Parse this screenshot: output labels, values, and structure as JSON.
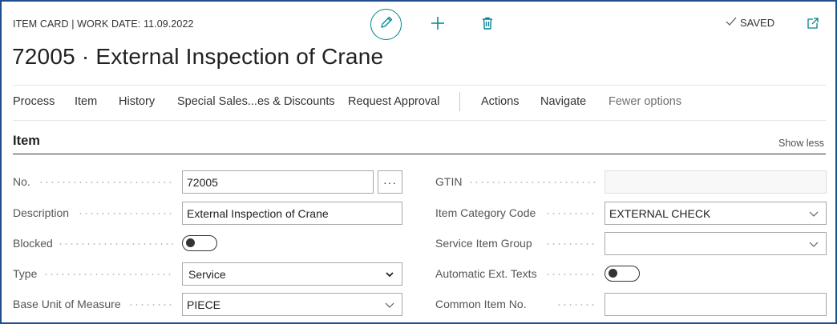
{
  "header": {
    "caption": "ITEM CARD | WORK DATE: 11.09.2022",
    "title": "72005 · External Inspection of Crane",
    "status": "SAVED"
  },
  "icons": {
    "edit": "pencil-icon",
    "new": "plus-icon",
    "delete": "trash-icon",
    "saved": "check-icon",
    "open_new_window": "open-in-new-window-icon"
  },
  "actions": [
    "Process",
    "Item",
    "History",
    "Special Sales...es & Discounts",
    "Request Approval",
    "Actions",
    "Navigate",
    "Fewer options"
  ],
  "section": {
    "title": "Item",
    "toggle_label": "Show less"
  },
  "fields_left": {
    "no": {
      "label": "No.",
      "value": "72005",
      "lookup": "···"
    },
    "description": {
      "label": "Description",
      "value": "External Inspection of Crane"
    },
    "blocked": {
      "label": "Blocked",
      "value": false
    },
    "type": {
      "label": "Type",
      "value": "Service"
    },
    "base_unit": {
      "label": "Base Unit of Measure",
      "value": "PIECE"
    }
  },
  "fields_right": {
    "gtin": {
      "label": "GTIN",
      "value": ""
    },
    "item_category": {
      "label": "Item Category Code",
      "value": "EXTERNAL CHECK"
    },
    "service_item_group": {
      "label": "Service Item Group",
      "value": ""
    },
    "auto_ext_texts": {
      "label": "Automatic Ext. Texts",
      "value": false
    },
    "common_item_no": {
      "label": "Common Item No.",
      "value": ""
    }
  },
  "colors": {
    "frame": "#1f4e8c",
    "accent": "#00838f",
    "text": "#212121"
  }
}
